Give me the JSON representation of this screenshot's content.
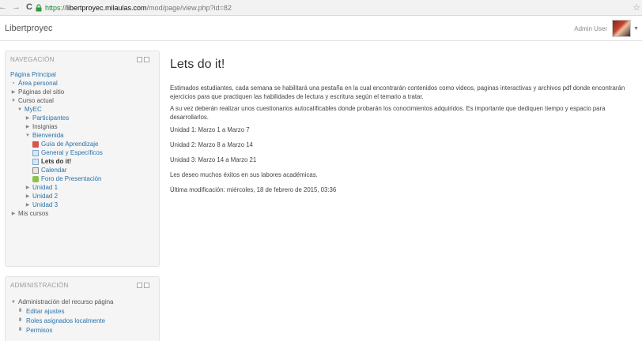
{
  "browser": {
    "back": "←",
    "forward": "→",
    "reload": "C",
    "url_scheme": "https://",
    "url_host": "libertproyec.milaulas.com",
    "url_path": "/mod/page/view.php?id=82"
  },
  "site": {
    "title": "Libertproyec",
    "user_name": "Admin User"
  },
  "navigation": {
    "title": "NAVEGACIÓN",
    "items": [
      {
        "label": "Página Principal"
      },
      {
        "label": "Área personal"
      },
      {
        "label": "Páginas del sitio"
      },
      {
        "label": "Curso actual"
      },
      {
        "label": "MyEC"
      },
      {
        "label": "Participantes"
      },
      {
        "label": "Insignias"
      },
      {
        "label": "Bienvenida"
      },
      {
        "label": "Guía de Aprendizaje"
      },
      {
        "label": "General y Específicos"
      },
      {
        "label": "Lets do it!"
      },
      {
        "label": "Calendar"
      },
      {
        "label": "Foro de Presentación"
      },
      {
        "label": "Unidad 1"
      },
      {
        "label": "Unidad 2"
      },
      {
        "label": "Unidad 3"
      },
      {
        "label": "Mis cursos"
      }
    ]
  },
  "administration": {
    "title": "ADMINISTRACIÓN",
    "items": [
      {
        "label": "Administración del recurso página"
      },
      {
        "label": "Editar ajustes"
      },
      {
        "label": "Roles asignados localmente"
      },
      {
        "label": "Permisos"
      }
    ]
  },
  "page": {
    "heading": "Lets do it!",
    "paragraphs": [
      "Estimados estudiantes, cada semana se habilitará una pestaña en la cual encontrarán contenidos como videos, paginas interactivas y archivos pdf donde encontrarán ejercicios para que practiquen las habilidades de lectura y escritura según el temario a tratar.",
      "A su vez deberán realizar unos cuestionarios autocalificables donde probarán los conocimientos adquiridos. Es importante que dediquen tiempo y espacio para desarrollarlos.",
      "Unidad 1: Marzo 1 a Marzo 7",
      "Unidad 2: Marzo 8 a Marzo 14",
      "Unidad 3: Marzo 14 a Marzo 21",
      "Les deseo muchos éxitos en sus labores académicas.",
      "Última modificación: miércoles, 18 de febrero de 2015, 03:36"
    ]
  }
}
